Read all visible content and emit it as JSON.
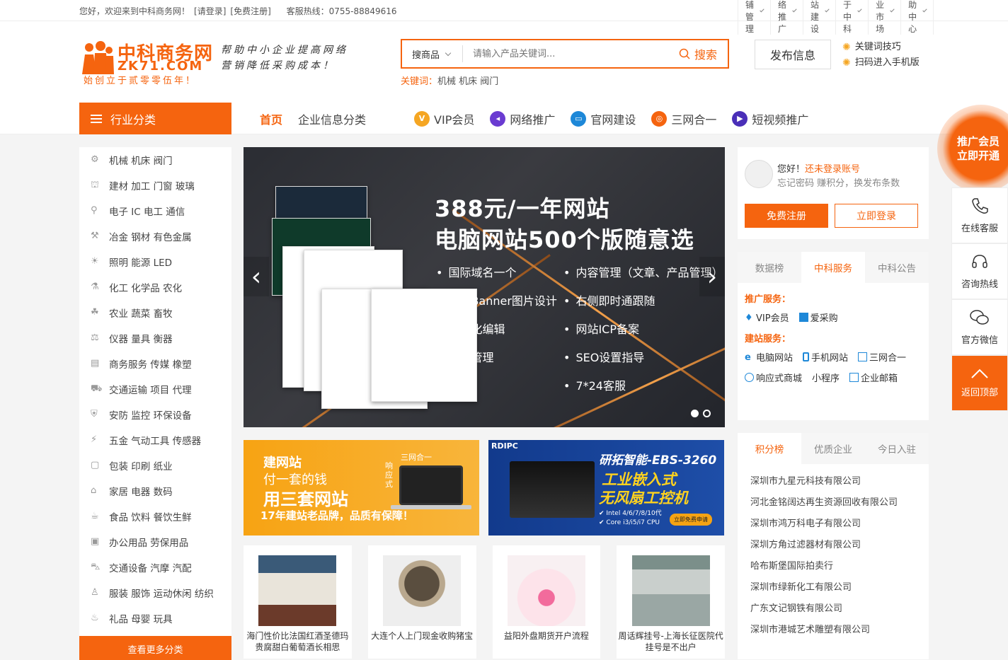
{
  "topbar": {
    "welcome": "您好，欢迎来到中科商务网！",
    "login": "[请登录]",
    "register": "[免费注册]",
    "hotline": "客服热线：0755-88849616",
    "menus": [
      "商铺管理",
      "网络推广",
      "网站建设",
      "关于中科",
      "行业市场",
      "帮助中心"
    ]
  },
  "header": {
    "logo_cn": "中科商务网",
    "logo_en": "ZK71.COM",
    "logo_sub": "始创立于贰零零伍年！",
    "slogan": "帮助中小企业提高网络营销降低采购成本！",
    "search_type": "搜商品",
    "search_placeholder": "请输入产品关键词...",
    "search_button": "搜索",
    "keywords_label": "关键词：",
    "keywords": "机械 机床 阀门",
    "publish": "发布信息",
    "link1": "关键词技巧",
    "link2": "扫码进入手机版"
  },
  "nav": {
    "category": "行业分类",
    "items": [
      "首页",
      "企业信息分类",
      "VIP会员",
      "网络推广",
      "官网建设",
      "三网合一",
      "短视频推广"
    ],
    "icon_colors": [
      "#f5a623",
      "#6a3bd1",
      "#1e88d8",
      "#f5640f",
      "#4a2fb8"
    ]
  },
  "sidebar": {
    "items": [
      "机械 机床 阀门",
      "建材 加工 门窗 玻璃",
      "电子 IC 电工 通信",
      "冶金 钢材 有色金属",
      "照明 能源 LED",
      "化工 化学品 农化",
      "农业 蔬菜 畜牧",
      "仪器 量具 衡器",
      "商务服务 传媒 橡塑",
      "交通运输 项目 代理",
      "安防 监控 环保设备",
      "五金 气动工具 传感器",
      "包装 印刷 纸业",
      "家居 电器 数码",
      "食品 饮料 餐饮生鲜",
      "办公用品 劳保用品",
      "交通设备 汽摩 汽配",
      "服装 服饰 运动休闲 纺织",
      "礼品 母婴 玩具"
    ],
    "more": "查看更多分类"
  },
  "banner": {
    "h1": "388元/一年网站",
    "h2": "电脑网站500个版随意选",
    "left_list": [
      "国际域名一个",
      "两张Banner图片设计",
      "可视化编辑",
      "栏目管理"
    ],
    "right_list": [
      "内容管理（文章、产品管理）",
      "右侧即时通跟随",
      "网站ICP备案",
      "SEO设置指导",
      "7*24客服"
    ]
  },
  "ad1": {
    "t1": "建网站",
    "t2": "付一套的钱",
    "t3": "用三套网站",
    "t4": "17年建站老品牌，品质有保障！",
    "side1": "三网合一",
    "side2": "响应式"
  },
  "ad2": {
    "brand": "RDIPC",
    "t1": "研拓智能-EBS-3260",
    "t2": "工业嵌入式",
    "t3": "无风扇工控机",
    "f1": "Intel 4/6/7/8/10代",
    "f2": "Core i3/i5/i7 CPU",
    "cta": "立即免费申请"
  },
  "products": [
    {
      "cap": "海门性价比法国红酒圣德玛贵腐甜白葡萄酒长相思"
    },
    {
      "cap": "大连个人上门现金收购猪宝"
    },
    {
      "cap": "益阳外盘期货开户流程"
    },
    {
      "cap": "周话辉挂号-上海长征医院代挂号是不出户"
    }
  ],
  "login": {
    "hello": "您好！",
    "not_logged": "还未登录账号",
    "sub": "忘记密码  赚积分，换发布条数",
    "register": "免费注册",
    "login": "立即登录"
  },
  "svc": {
    "tabs": [
      "数据榜",
      "中科服务",
      "中科公告"
    ],
    "promo_title": "推广服务：",
    "promo_items": [
      "VIP会员",
      "爱采购"
    ],
    "build_title": "建站服务：",
    "build_row1": [
      "电脑网站",
      "手机网站",
      "三网合一"
    ],
    "build_row2": [
      "响应式商城",
      "小程序",
      "企业邮箱"
    ]
  },
  "rank": {
    "tabs": [
      "积分榜",
      "优质企业",
      "今日入驻"
    ],
    "items": [
      "深圳市九星元科技有限公司",
      "河北金铭阔达再生资源回收有限公司",
      "深圳市鸿万科电子有限公司",
      "深圳方角过滤器材有限公司",
      "哈布斯堡国际拍卖行",
      "深圳市绿新化工有限公司",
      "广东文记钢铁有限公司",
      "深圳市港城艺术雕塑有限公司"
    ]
  },
  "float": {
    "promo_l1": "推广会员",
    "promo_l2": "立即开通",
    "kefu": "在线客服",
    "hotline": "咨询热线",
    "wechat": "官方微信",
    "top": "返回顶部"
  }
}
